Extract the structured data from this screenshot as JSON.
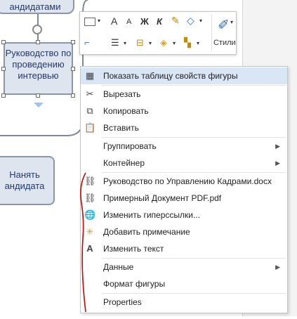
{
  "diagram": {
    "shape_top_label": "андидатами",
    "shape_interview_label": "Руководство по проведению интервью",
    "shape_hire_label": "Нанять андидата"
  },
  "mini_toolbar": {
    "bold_label": "Ж",
    "italic_label": "К",
    "grow_font_label": "A",
    "shrink_font_label": "A",
    "styles_label": "Стили"
  },
  "context_menu": {
    "items": [
      {
        "label": "Показать таблицу свойств фигуры",
        "icon": "table-icon"
      },
      {
        "label": "Вырезать",
        "icon": "scissors-icon"
      },
      {
        "label": "Копировать",
        "icon": "copy-icon"
      },
      {
        "label": "Вставить",
        "icon": "paste-icon"
      },
      {
        "label": "Группировать",
        "icon": "",
        "submenu": true
      },
      {
        "label": "Контейнер",
        "icon": "",
        "submenu": true
      },
      {
        "label": "Руководство по Управлению Кадрами.docx",
        "icon": "link-icon"
      },
      {
        "label": "Примерный Документ PDF.pdf",
        "icon": "link-icon"
      },
      {
        "label": "Изменить гиперссылки...",
        "icon": "globe-link-icon"
      },
      {
        "label": "Добавить примечание",
        "icon": "comment-icon"
      },
      {
        "label": "Изменить текст",
        "icon": "text-a-icon"
      },
      {
        "label": "Данные",
        "icon": "",
        "submenu": true
      },
      {
        "label": "Формат фигуры",
        "icon": ""
      },
      {
        "label": "Properties",
        "icon": ""
      }
    ]
  },
  "colors": {
    "shape_fill": "#dfe5ef",
    "shape_border": "#8a96aa",
    "shape_text": "#1f3a73",
    "annotation_red": "#d40000",
    "menu_highlight": "#d9e6f5"
  }
}
